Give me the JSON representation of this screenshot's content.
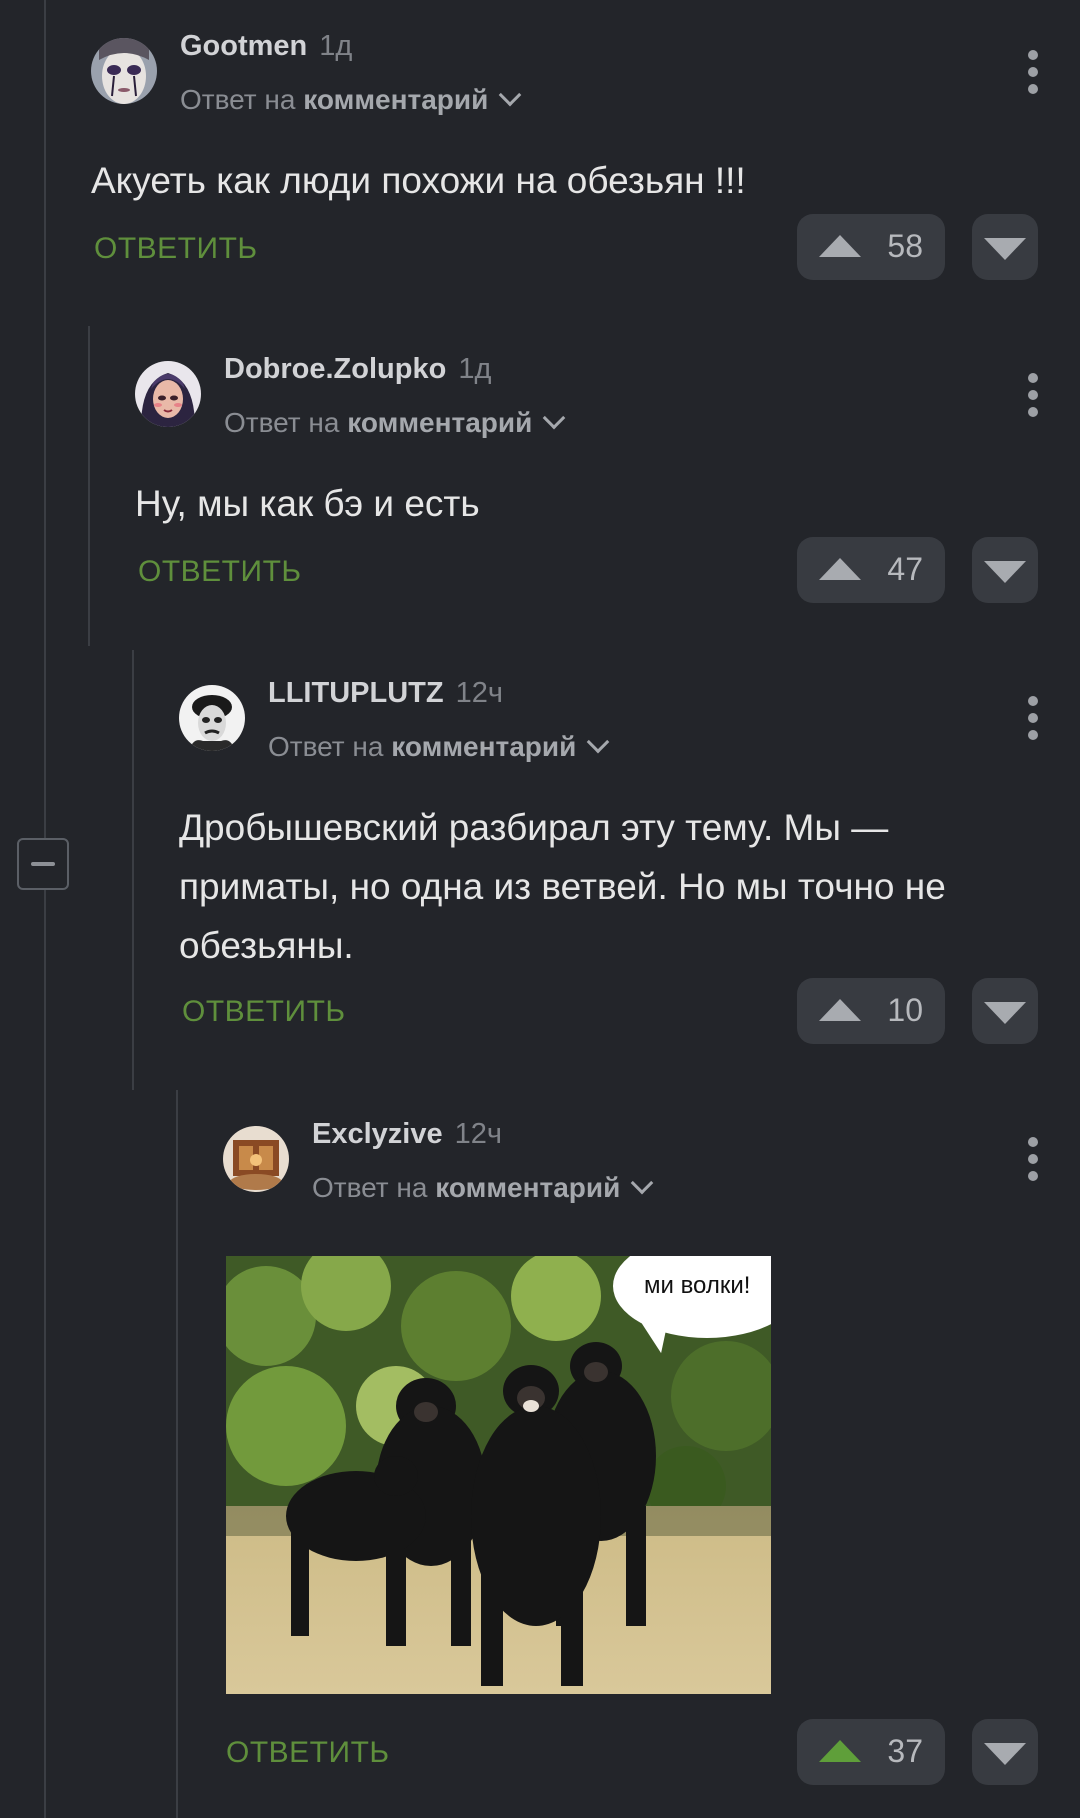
{
  "thread_control": {
    "collapse_icon": "minus-icon"
  },
  "comments": [
    {
      "username": "Gootmen",
      "time": "1д",
      "reply_prefix": "Ответ на",
      "reply_target": "комментарий",
      "text": "Акуеть как люди похожи на обезьян !!!",
      "reply_label": "ОТВЕТИТЬ",
      "rating": "58"
    },
    {
      "username": "Dobroe.Zolupko",
      "time": "1д",
      "reply_prefix": "Ответ на",
      "reply_target": "комментарий",
      "text": "Ну, мы как бэ и есть",
      "reply_label": "ОТВЕТИТЬ",
      "rating": "47"
    },
    {
      "username": "LLITUPLUTZ",
      "time": "12ч",
      "reply_prefix": "Ответ на",
      "reply_target": "комментарий",
      "text": "Дробышевский разбирал эту тему. Мы — приматы, но одна из ветвей. Но мы точно не обезьяны.",
      "reply_label": "ОТВЕТИТЬ",
      "rating": "10"
    },
    {
      "username": "Exclyzive",
      "time": "12ч",
      "reply_prefix": "Ответ на",
      "reply_target": "комментарий",
      "image_caption": "ми волки!",
      "reply_label": "ОТВЕТИТЬ",
      "rating": "37",
      "upvoted": true
    }
  ],
  "colors": {
    "background": "#23252a",
    "reply_green": "#5f8f3c",
    "upvote_active": "#5f9f3a"
  }
}
